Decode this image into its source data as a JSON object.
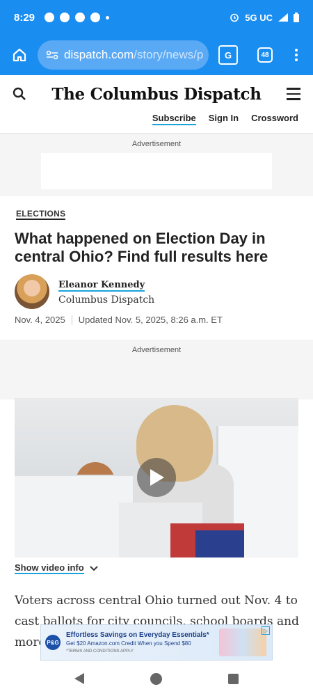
{
  "status": {
    "time": "8:29",
    "network": "5G UC"
  },
  "browser": {
    "url_host": "dispatch.com",
    "url_path": "/story/news/p",
    "tab_count": "48"
  },
  "site": {
    "logo": "The Columbus Dispatch",
    "links": {
      "subscribe": "Subscribe",
      "sign_in": "Sign In",
      "crossword": "Crossword"
    }
  },
  "ads": {
    "label_top": "Advertisement",
    "label_mid": "Advertisement",
    "bottom": {
      "brand": "P&G",
      "line1": "Effortless Savings on Everyday Essentials*",
      "line2": "Get $20 Amazon.com Credit When you Spend $80",
      "line3": "*TERMS AND CONDITIONS APPLY"
    }
  },
  "article": {
    "kicker": "ELECTIONS",
    "headline": "What happened on Election Day in central Ohio? Find full results here",
    "author": "Eleanor Kennedy",
    "outlet": "Columbus Dispatch",
    "published": "Nov. 4, 2025",
    "updated": "Updated Nov. 5, 2025, 8:26 a.m. ET",
    "show_video_info": "Show video info",
    "body": "Voters across central Ohio turned out Nov. 4 to cast ballots for city councils, school boards and more"
  },
  "colors": {
    "browser_blue": "#1a8df0",
    "link_underline": "#1aa4d8"
  },
  "icons": {
    "home": "home-icon",
    "site_settings": "site-settings-icon",
    "translate": "translate-icon",
    "search": "search-icon",
    "menu": "hamburger-icon",
    "play": "play-icon",
    "chevron": "chevron-down-icon"
  }
}
